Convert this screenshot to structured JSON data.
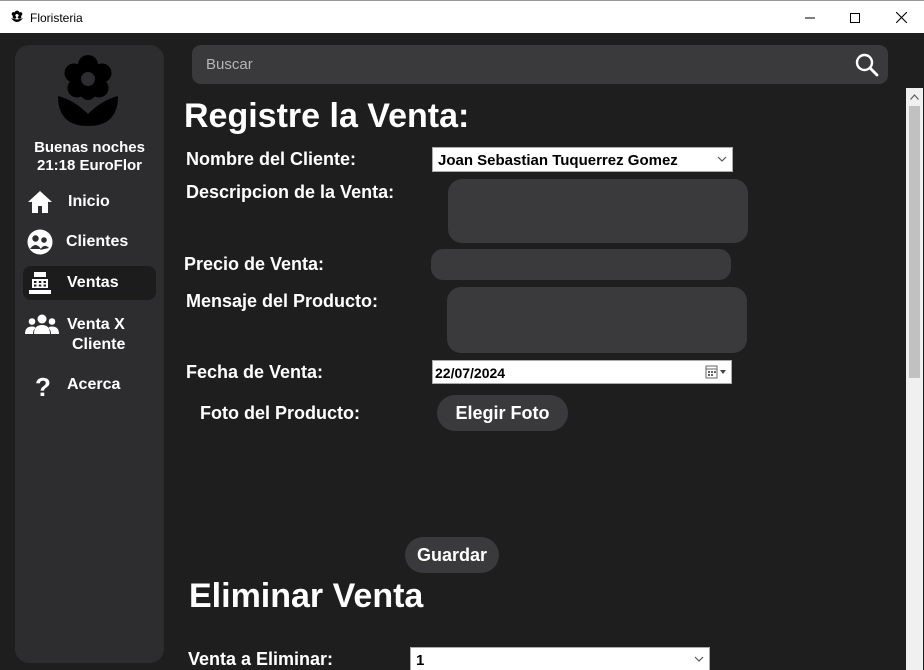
{
  "window": {
    "title": "Floristeria"
  },
  "search": {
    "placeholder": "Buscar"
  },
  "sidebar": {
    "greeting_line1": "Buenas noches",
    "greeting_line2": "21:18 EuroFlor",
    "items": [
      {
        "label": "Inicio",
        "icon": "home-icon"
      },
      {
        "label": "Clientes",
        "icon": "clients-icon"
      },
      {
        "label": "Ventas",
        "icon": "cash-register-icon",
        "active": true
      },
      {
        "label": "Venta X",
        "label2": "Cliente",
        "icon": "people-icon"
      },
      {
        "label": "Acerca",
        "icon": "question-icon"
      }
    ]
  },
  "form": {
    "title": "Registre la Venta:",
    "client_label": "Nombre del Cliente:",
    "client_value": "Joan Sebastian Tuquerrez Gomez",
    "description_label": "Descripcion de la Venta:",
    "price_label": "Precio de Venta:",
    "message_label": "Mensaje del Producto:",
    "date_label": "Fecha de Venta:",
    "date_value": "22/07/2024",
    "photo_label": "Foto del Producto:",
    "photo_button": "Elegir Foto",
    "save_button": "Guardar"
  },
  "delete": {
    "title": "Eliminar Venta",
    "label": "Venta a Eliminar:",
    "value": "1"
  },
  "colors": {
    "background": "#1e1e1e",
    "panel": "#2d2d30",
    "field": "#3a3a3c",
    "text": "#ffffff"
  }
}
